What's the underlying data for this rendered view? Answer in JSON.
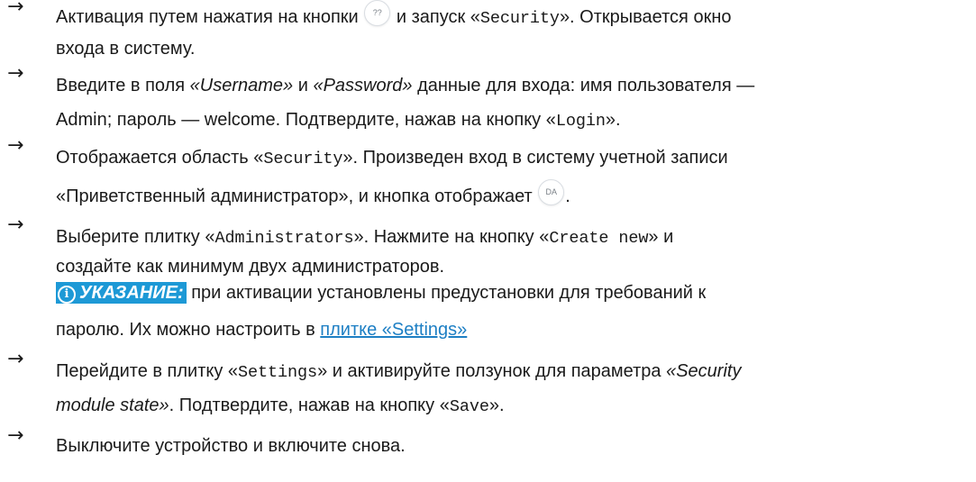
{
  "steps": [
    {
      "l1_a": "Активация путем нажатия на кнопки",
      "icon_text": "??",
      "l1_b": "и запуск «",
      "l1_code": "Security",
      "l1_c": "». Открывается окно",
      "l2": "входа в систему."
    },
    {
      "l1_a": "Введите в поля ",
      "l1_it1": "«Username»",
      "l1_b": " и ",
      "l1_it2": "«Password»",
      "l1_c": " данные для входа: имя пользователя —",
      "l2_a": "Admin; пароль — welcome. Подтвердите, нажав на кнопку «",
      "l2_code": "Login",
      "l2_b": "»."
    },
    {
      "l1_a": "Отображается область «",
      "l1_code": "Security",
      "l1_b": "». Произведен вход в систему учетной записи",
      "l2_a": "«Приветственный администратор», и кнопка отображает",
      "icon_text": "DA",
      "l2_b": "."
    },
    {
      "l1_a": "Выберите плитку «",
      "l1_code": "Administrators",
      "l1_b": "». Нажмите на кнопку «",
      "l1_code2": "Create new",
      "l1_c": "» и",
      "l2": "создайте как минимум двух администраторов.",
      "hint_icon": "i",
      "hint_label": "УКАЗАНИЕ:",
      "hint_text": " при активации установлены предустановки для требований к",
      "l4_a": "паролю. Их можно настроить в ",
      "l4_link": "плитке «Settings»"
    },
    {
      "l1_a": "Перейдите в плитку «",
      "l1_code": "Settings",
      "l1_b": "» и активируйте ползунок для параметра ",
      "l1_it": "«Security",
      "l2_it": "module state»",
      "l2_a": ". Подтвердите, нажав на кнопку «",
      "l2_code": "Save",
      "l2_b": "»."
    },
    {
      "l1": "Выключите устройство и включите снова."
    }
  ],
  "arrow_glyph": "→"
}
